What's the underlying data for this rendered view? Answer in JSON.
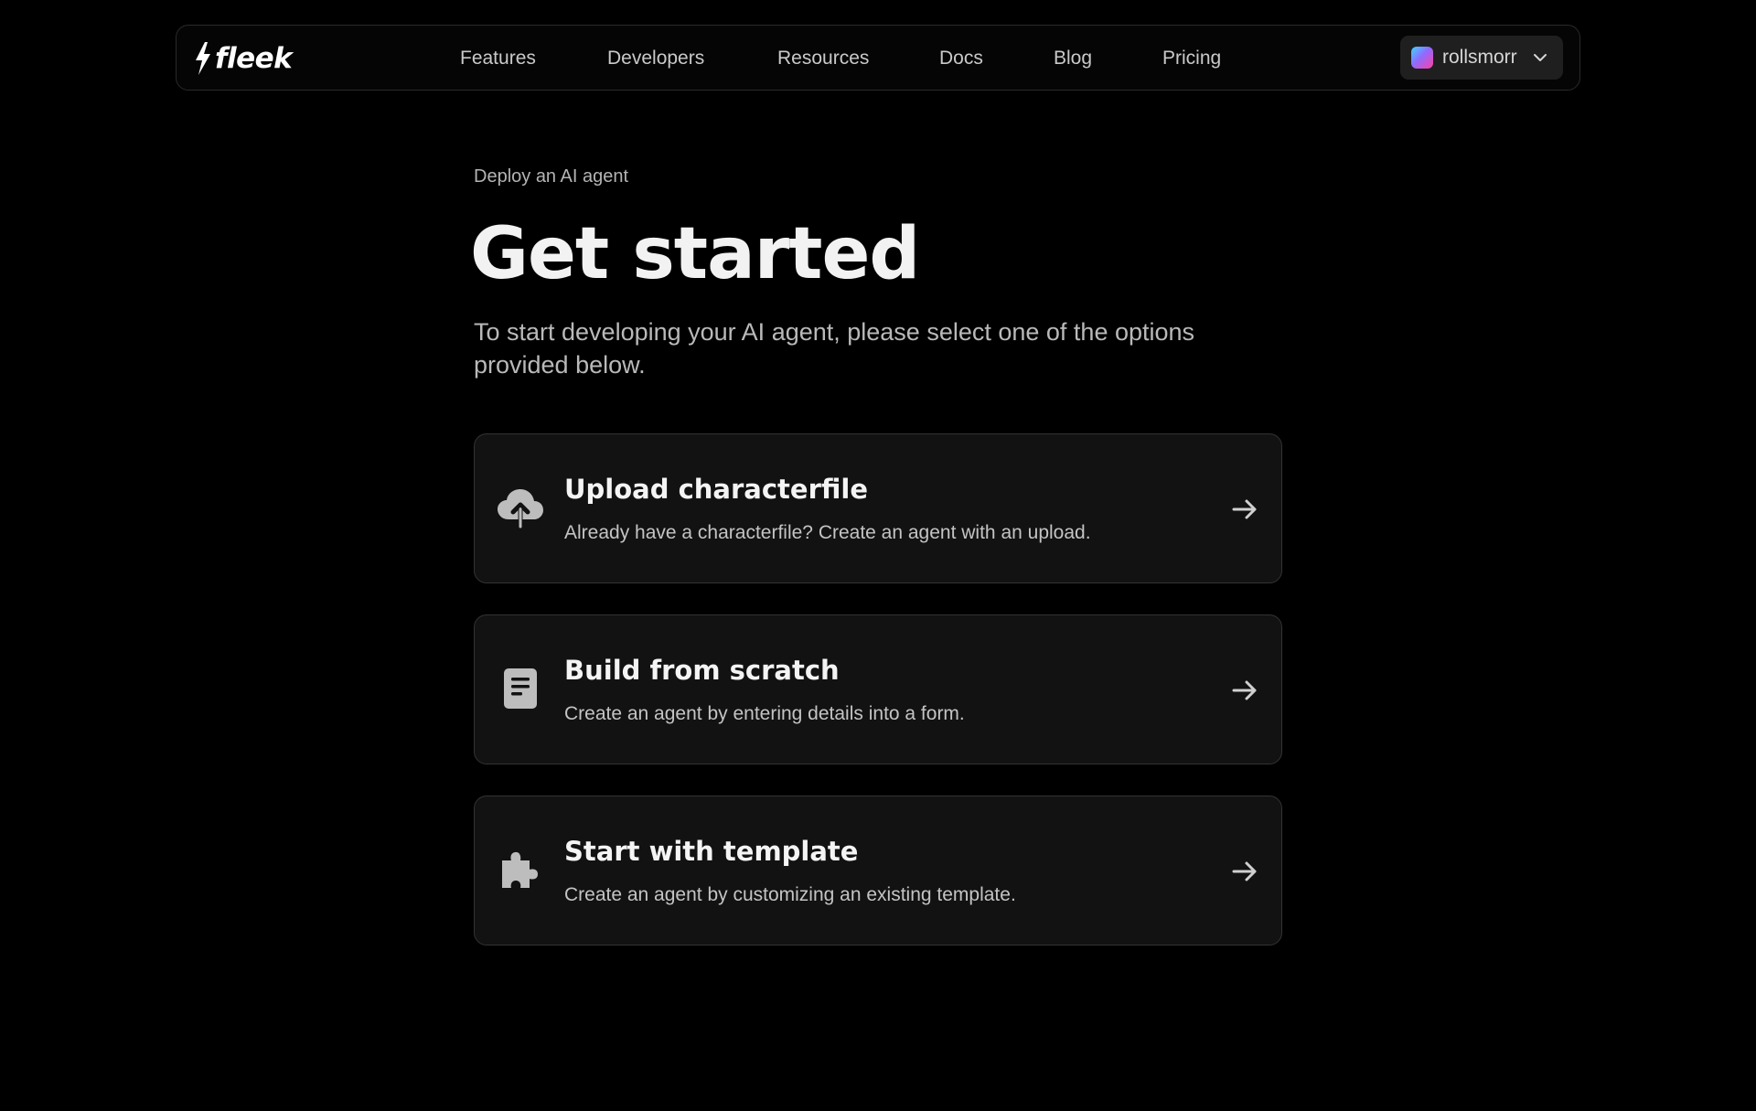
{
  "navbar": {
    "logo_text": "fleek",
    "links": [
      {
        "label": "Features"
      },
      {
        "label": "Developers"
      },
      {
        "label": "Resources"
      },
      {
        "label": "Docs"
      },
      {
        "label": "Blog"
      },
      {
        "label": "Pricing"
      }
    ],
    "account": {
      "username": "rollsmorr",
      "avatar_gradient": [
        "#3fd6ff",
        "#8f6bff",
        "#ff3fa4"
      ],
      "icon": "chevron-down-icon"
    }
  },
  "main": {
    "eyebrow": "Deploy an AI agent",
    "title": "Get started",
    "subtitle": "To start developing your AI agent, please select one of the options provided below.",
    "options": [
      {
        "title": "Upload characterfile",
        "description": "Already have a characterfile? Create an agent with an upload.",
        "icon": "cloud-upload-icon"
      },
      {
        "title": "Build from scratch",
        "description": "Create an agent by entering details into a form.",
        "icon": "document-icon"
      },
      {
        "title": "Start with template",
        "description": "Create an agent by customizing an existing template.",
        "icon": "puzzle-icon"
      }
    ]
  },
  "colors": {
    "background": "#000000",
    "card_background": "#121212",
    "card_border": "#333333",
    "text_primary": "#f4f4f4",
    "text_secondary": "#c4c4c4",
    "icon": "#bdbdbd"
  }
}
